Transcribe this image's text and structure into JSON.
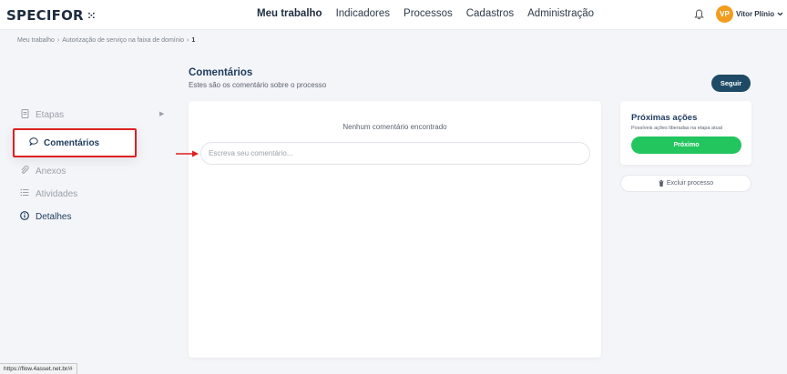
{
  "header": {
    "logo": "SPECIFOR",
    "nav": [
      "Meu trabalho",
      "Indicadores",
      "Processos",
      "Cadastros",
      "Administração"
    ],
    "active_nav": "Meu trabalho",
    "avatar_initials": "VP",
    "user_name": "Vitor Plínio",
    "avatar_color": "#f29d1e"
  },
  "breadcrumb": [
    "Meu trabalho",
    "Autorização de serviço na faixa de domínio",
    "1"
  ],
  "sidebar": {
    "items": [
      {
        "label": "Etapas",
        "icon": "document-icon"
      },
      {
        "label": "Comentários",
        "icon": "chat-bubble-icon"
      },
      {
        "label": "Anexos",
        "icon": "paperclip-icon"
      },
      {
        "label": "Atividades",
        "icon": "list-icon"
      },
      {
        "label": "Detalhes",
        "icon": "info-icon"
      }
    ],
    "active": "Comentários"
  },
  "main": {
    "title": "Comentários",
    "subtitle": "Estes são os comentário sobre o processo",
    "empty_text": "Nenhum comentário encontrado",
    "input_placeholder": "Escreva seu comentário..."
  },
  "follow_button": "Seguir",
  "actions_panel": {
    "title": "Próximas ações",
    "subtitle": "Possíveis ações liberadas na etapa atual",
    "next_button": "Próximo",
    "next_color": "#22c55e"
  },
  "delete_button": "Excluir processo",
  "status_url": "https://flow.4asset.net.br/#",
  "colors": {
    "primary": "#1e3a5c",
    "follow": "#1e4a66",
    "highlight": "#e02020"
  }
}
